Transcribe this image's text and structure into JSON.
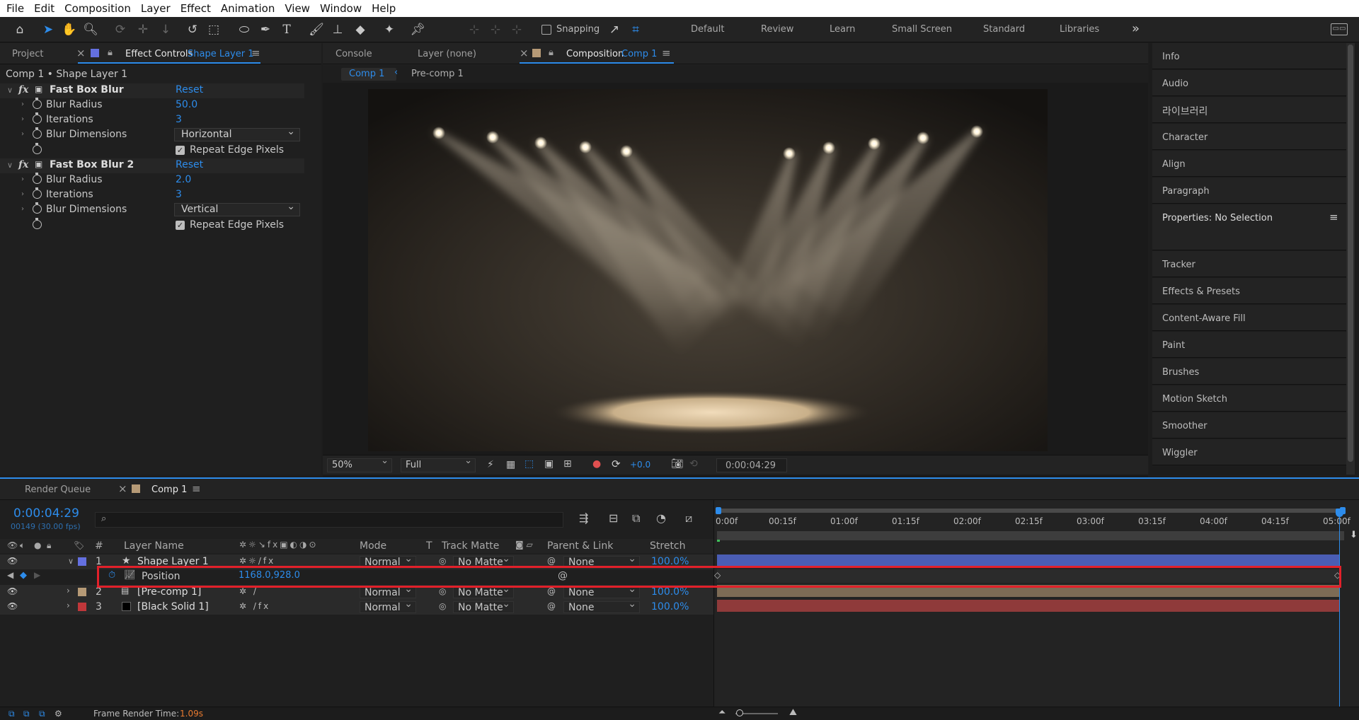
{
  "menu": [
    "File",
    "Edit",
    "Composition",
    "Layer",
    "Effect",
    "Animation",
    "View",
    "Window",
    "Help"
  ],
  "toolbar": {
    "snapping_label": "Snapping",
    "workspaces": [
      "Default",
      "Review",
      "Learn",
      "Small Screen",
      "Standard",
      "Libraries"
    ],
    "more": "»"
  },
  "left_tabs": {
    "project": "Project",
    "effect_controls": "Effect Controls",
    "effect_controls_layer": "Shape Layer 1",
    "close": "×",
    "menu": "≡"
  },
  "effect_controls": {
    "breadcrumb": "Comp 1 • Shape Layer 1",
    "effects": [
      {
        "name": "Fast Box Blur",
        "reset": "Reset",
        "blur_radius_label": "Blur Radius",
        "blur_radius": "50.0",
        "iterations_label": "Iterations",
        "iterations": "3",
        "dims_label": "Blur Dimensions",
        "dims": "Horizontal",
        "repeat_label": "Repeat Edge Pixels"
      },
      {
        "name": "Fast Box Blur 2",
        "reset": "Reset",
        "blur_radius_label": "Blur Radius",
        "blur_radius": "2.0",
        "iterations_label": "Iterations",
        "iterations": "3",
        "dims_label": "Blur Dimensions",
        "dims": "Vertical",
        "repeat_label": "Repeat Edge Pixels"
      }
    ]
  },
  "center_tabs": {
    "console": "Console",
    "layer": "Layer (none)",
    "composition": "Composition",
    "composition_name": "Comp 1",
    "close": "×",
    "menu": "≡"
  },
  "comp_nav": {
    "active": "Comp 1",
    "next": "Pre-comp 1"
  },
  "viewer_bar": {
    "zoom": "50%",
    "resolution": "Full",
    "exposure": "+0.0",
    "timecode": "0:00:04:29"
  },
  "right_panels": [
    "Info",
    "Audio",
    "라이브러리",
    "Character",
    "Align",
    "Paragraph",
    "Properties: No Selection",
    "Tracker",
    "Effects & Presets",
    "Content-Aware Fill",
    "Paint",
    "Brushes",
    "Motion Sketch",
    "Smoother",
    "Wiggler"
  ],
  "timeline": {
    "tabs": {
      "render_queue": "Render Queue",
      "comp": "Comp 1",
      "close": "×",
      "menu": "≡"
    },
    "timecode": "0:00:04:29",
    "frame_info": "00149 (30.00 fps)",
    "search_placeholder": "",
    "headers": {
      "num": "#",
      "layer_name": "Layer Name",
      "mode": "Mode",
      "t": "T",
      "track_matte": "Track Matte",
      "parent": "Parent & Link",
      "stretch": "Stretch"
    },
    "ruler": [
      "0:00f",
      "00:15f",
      "01:00f",
      "01:15f",
      "02:00f",
      "02:15f",
      "03:00f",
      "03:15f",
      "04:00f",
      "04:15f",
      "05:00f"
    ],
    "layers": [
      {
        "num": "1",
        "name": "Shape Layer 1",
        "mode": "Normal",
        "matte": "No Matte",
        "parent": "None",
        "stretch": "100.0%",
        "color": "#6470e0"
      },
      {
        "num": "2",
        "name": "[Pre-comp 1]",
        "mode": "Normal",
        "matte": "No Matte",
        "parent": "None",
        "stretch": "100.0%",
        "color": "#b69a76"
      },
      {
        "num": "3",
        "name": "[Black Solid 1]",
        "mode": "Normal",
        "matte": "No Matte",
        "parent": "None",
        "stretch": "100.0%",
        "color": "#c0373a"
      }
    ],
    "position_prop": {
      "label": "Position",
      "value": "1168.0,928.0"
    },
    "status": {
      "render_label": "Frame Render Time:",
      "render_value": "1.09s"
    }
  },
  "colors": {
    "accent": "#2d8ceb",
    "highlight": "#e2202a"
  }
}
